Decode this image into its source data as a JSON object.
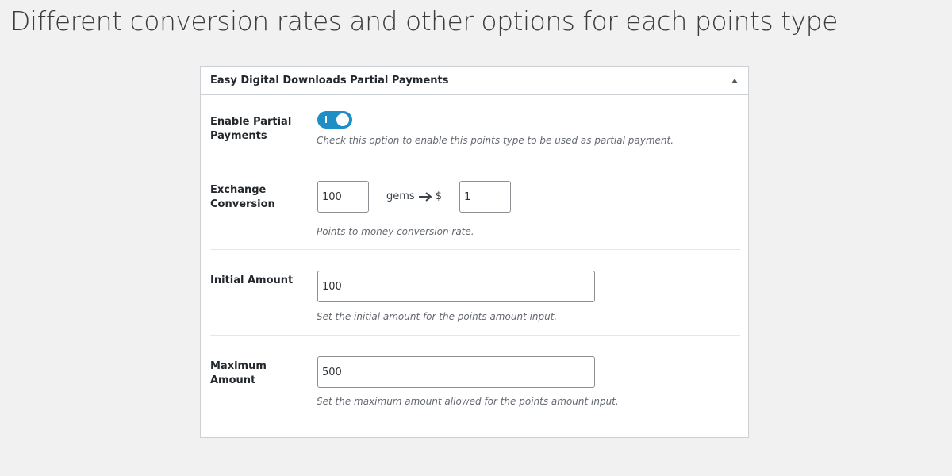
{
  "page": {
    "heading": "Different conversion rates and other options for each points type"
  },
  "panel": {
    "title": "Easy Digital Downloads Partial Payments",
    "fields": {
      "enable": {
        "label": "Enable Partial Payments",
        "enabled": true,
        "on_mark": "I",
        "description": "Check this option to enable this points type to be used as partial payment."
      },
      "exchange": {
        "label": "Exchange Conversion",
        "points_value": "100",
        "points_unit": "gems",
        "currency_symbol": "$",
        "money_value": "1",
        "description": "Points to money conversion rate."
      },
      "initial": {
        "label": "Initial Amount",
        "value": "100",
        "description": "Set the initial amount for the points amount input."
      },
      "maximum": {
        "label": "Maximum Amount",
        "value": "500",
        "description": "Set the maximum amount allowed for the points amount input."
      }
    }
  },
  "colors": {
    "toggle_on": "#1e8fc5",
    "background": "#f1f1f1"
  },
  "icons": {
    "collapse": "triangle-up-icon",
    "arrow": "right-arrow-icon"
  }
}
